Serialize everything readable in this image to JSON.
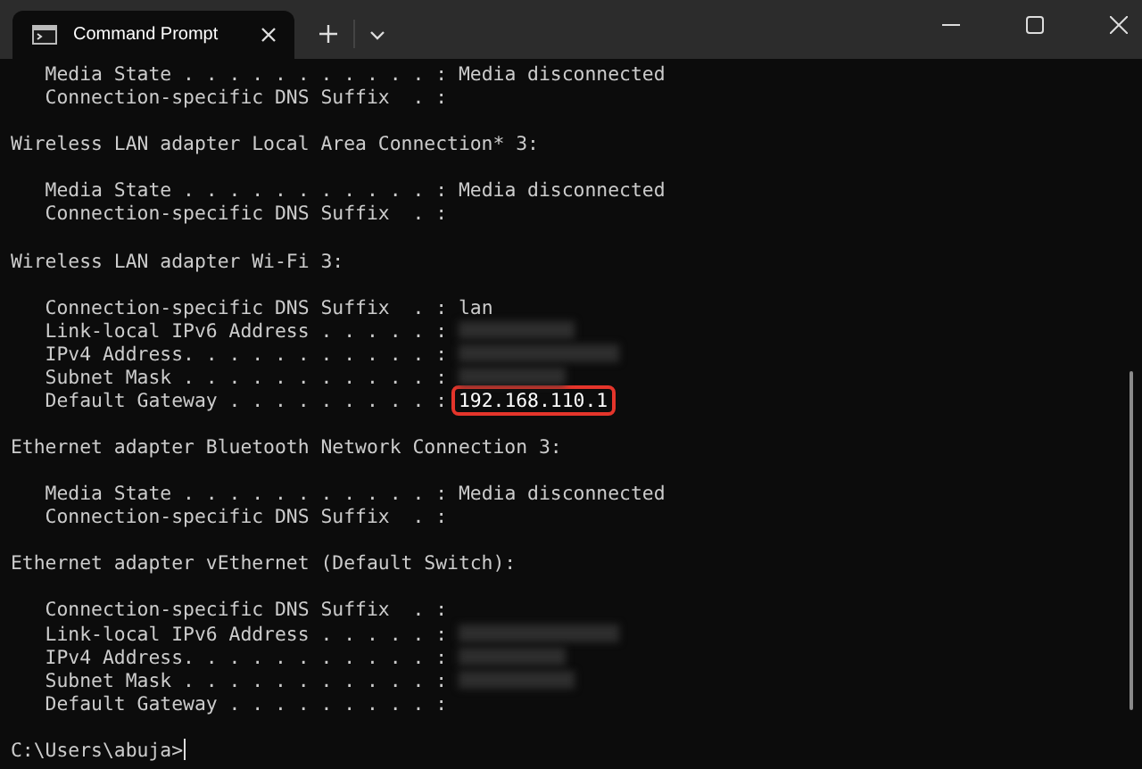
{
  "window": {
    "tab_title": "Command Prompt"
  },
  "lines": [
    {
      "kind": "field",
      "label": "   Media State . . . . . . . . . . . : ",
      "value": "Media disconnected"
    },
    {
      "kind": "field",
      "label": "   Connection-specific DNS Suffix  . : "
    },
    {
      "kind": "blank"
    },
    {
      "kind": "text",
      "text": "Wireless LAN adapter Local Area Connection* 3:"
    },
    {
      "kind": "blank"
    },
    {
      "kind": "field",
      "label": "   Media State . . . . . . . . . . . : ",
      "value": "Media disconnected"
    },
    {
      "kind": "field",
      "label": "   Connection-specific DNS Suffix  . : "
    },
    {
      "kind": "blank"
    },
    {
      "kind": "text",
      "text": "Wireless LAN adapter Wi-Fi 3:"
    },
    {
      "kind": "blank"
    },
    {
      "kind": "field",
      "label": "   Connection-specific DNS Suffix  . : ",
      "value": "lan"
    },
    {
      "kind": "field",
      "label": "   Link-local IPv6 Address . . . . . : ",
      "redacted": true
    },
    {
      "kind": "field",
      "label": "   IPv4 Address. . . . . . . . . . . : ",
      "redacted": true
    },
    {
      "kind": "field",
      "label": "   Subnet Mask . . . . . . . . . . . : ",
      "redacted": true
    },
    {
      "kind": "field",
      "label": "   Default Gateway . . . . . . . . . : ",
      "value": "192.168.110.1",
      "highlighted": true
    },
    {
      "kind": "blank"
    },
    {
      "kind": "text",
      "text": "Ethernet adapter Bluetooth Network Connection 3:"
    },
    {
      "kind": "blank"
    },
    {
      "kind": "field",
      "label": "   Media State . . . . . . . . . . . : ",
      "value": "Media disconnected"
    },
    {
      "kind": "field",
      "label": "   Connection-specific DNS Suffix  . : "
    },
    {
      "kind": "blank"
    },
    {
      "kind": "text",
      "text": "Ethernet adapter vEthernet (Default Switch):"
    },
    {
      "kind": "blank"
    },
    {
      "kind": "field",
      "label": "   Connection-specific DNS Suffix  . : "
    },
    {
      "kind": "field",
      "label": "   Link-local IPv6 Address . . . . . : ",
      "redacted": true
    },
    {
      "kind": "field",
      "label": "   IPv4 Address. . . . . . . . . . . : ",
      "redacted": true
    },
    {
      "kind": "field",
      "label": "   Subnet Mask . . . . . . . . . . . : ",
      "redacted": true
    },
    {
      "kind": "field",
      "label": "   Default Gateway . . . . . . . . . : "
    },
    {
      "kind": "blank"
    },
    {
      "kind": "prompt",
      "text": "C:\\Users\\abuja>"
    }
  ]
}
